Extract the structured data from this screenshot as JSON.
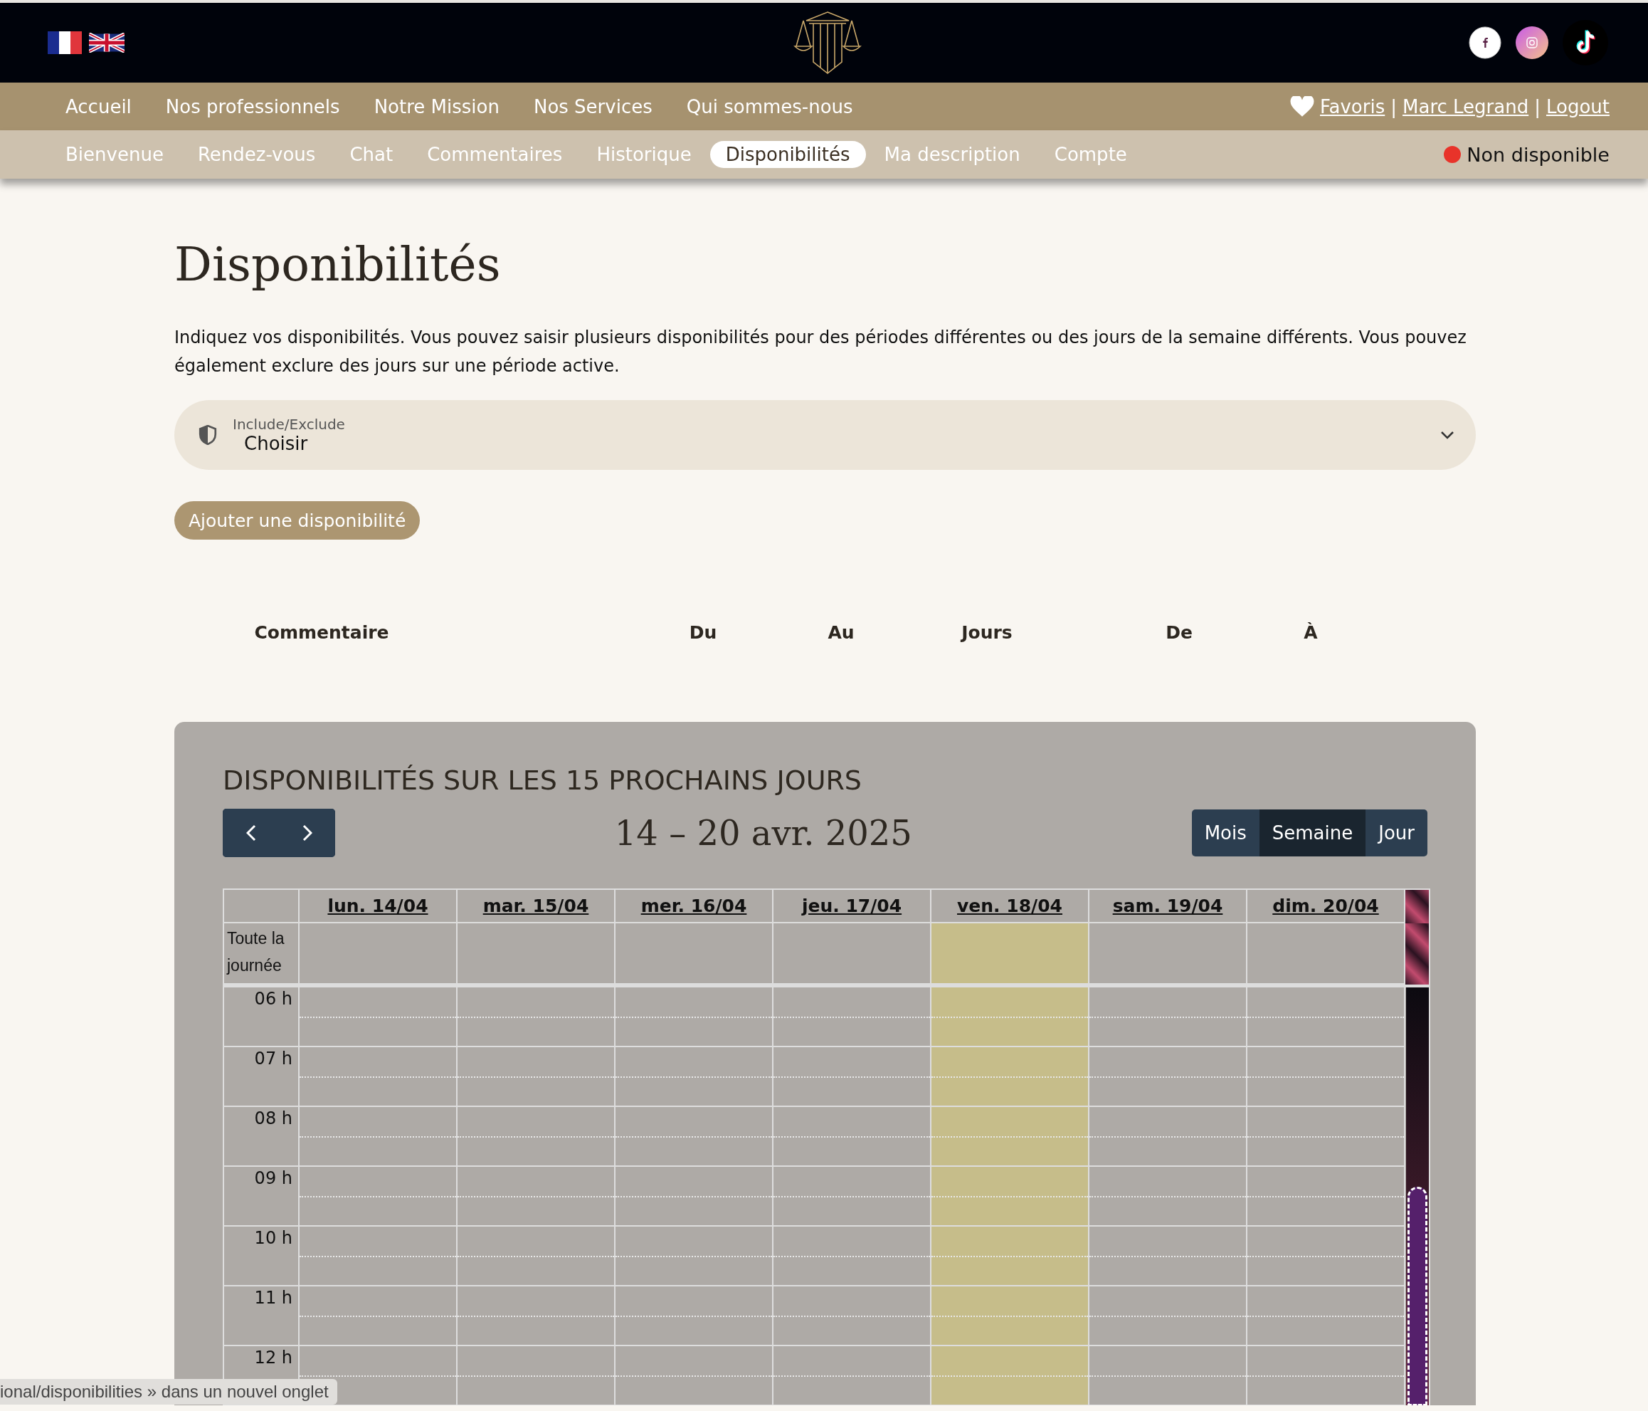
{
  "main_nav": {
    "items": [
      {
        "label": "Accueil"
      },
      {
        "label": "Nos professionnels"
      },
      {
        "label": "Notre Mission"
      },
      {
        "label": "Nos Services"
      },
      {
        "label": "Qui sommes-nous"
      }
    ],
    "user_links": [
      {
        "kind": "favorites",
        "label": " Favoris"
      },
      {
        "kind": "separator",
        "label": "|"
      },
      {
        "kind": "link",
        "label": "Marc Legrand"
      },
      {
        "kind": "separator",
        "label": "|"
      },
      {
        "kind": "link",
        "label": "Logout"
      }
    ]
  },
  "sub_nav": {
    "items": [
      {
        "label": "Bienvenue",
        "selected": false
      },
      {
        "label": "Rendez-vous",
        "selected": false
      },
      {
        "label": "Chat",
        "selected": false
      },
      {
        "label": "Commentaires",
        "selected": false
      },
      {
        "label": "Historique",
        "selected": false
      },
      {
        "label": "Disponibilités",
        "selected": true
      },
      {
        "label": "Ma description",
        "selected": false
      },
      {
        "label": "Compte",
        "selected": false
      }
    ],
    "status": {
      "label": "Non disponible",
      "available": false
    }
  },
  "page": {
    "title": "Disponibilités",
    "intro": "Indiquez vos disponibilités. Vous pouvez saisir plusieurs disponibilités pour des périodes différentes ou des jours de la semaine différents. Vous pouvez également exclure des jours sur une période active.",
    "select": {
      "label": "Include/Exclude",
      "value": "Choisir"
    },
    "add_button": "Ajouter une disponibilité",
    "table": {
      "columns": [
        "Commentaire",
        "Du",
        "Au",
        "Jours",
        "De",
        "À"
      ]
    }
  },
  "calendar": {
    "title": "DISPONIBILITÉS SUR LES 15 PROCHAINS JOURS",
    "range": "14 – 20 avr. 2025",
    "views": [
      {
        "label": "Mois",
        "selected": false
      },
      {
        "label": "Semaine",
        "selected": true
      },
      {
        "label": "Jour",
        "selected": false
      }
    ],
    "days": [
      {
        "label": "lun. 14/04",
        "today": false
      },
      {
        "label": "mar. 15/04",
        "today": false
      },
      {
        "label": "mer. 16/04",
        "today": false
      },
      {
        "label": "jeu. 17/04",
        "today": false
      },
      {
        "label": "ven. 18/04",
        "today": true
      },
      {
        "label": "sam. 19/04",
        "today": false
      },
      {
        "label": "dim. 20/04",
        "today": false
      }
    ],
    "all_day_label": "Toute la journée",
    "hours": [
      "06 h",
      "07 h",
      "08 h",
      "09 h",
      "10 h",
      "11 h",
      "12 h"
    ]
  },
  "status_tooltip": "ional/disponibilities » dans un nouvel onglet"
}
